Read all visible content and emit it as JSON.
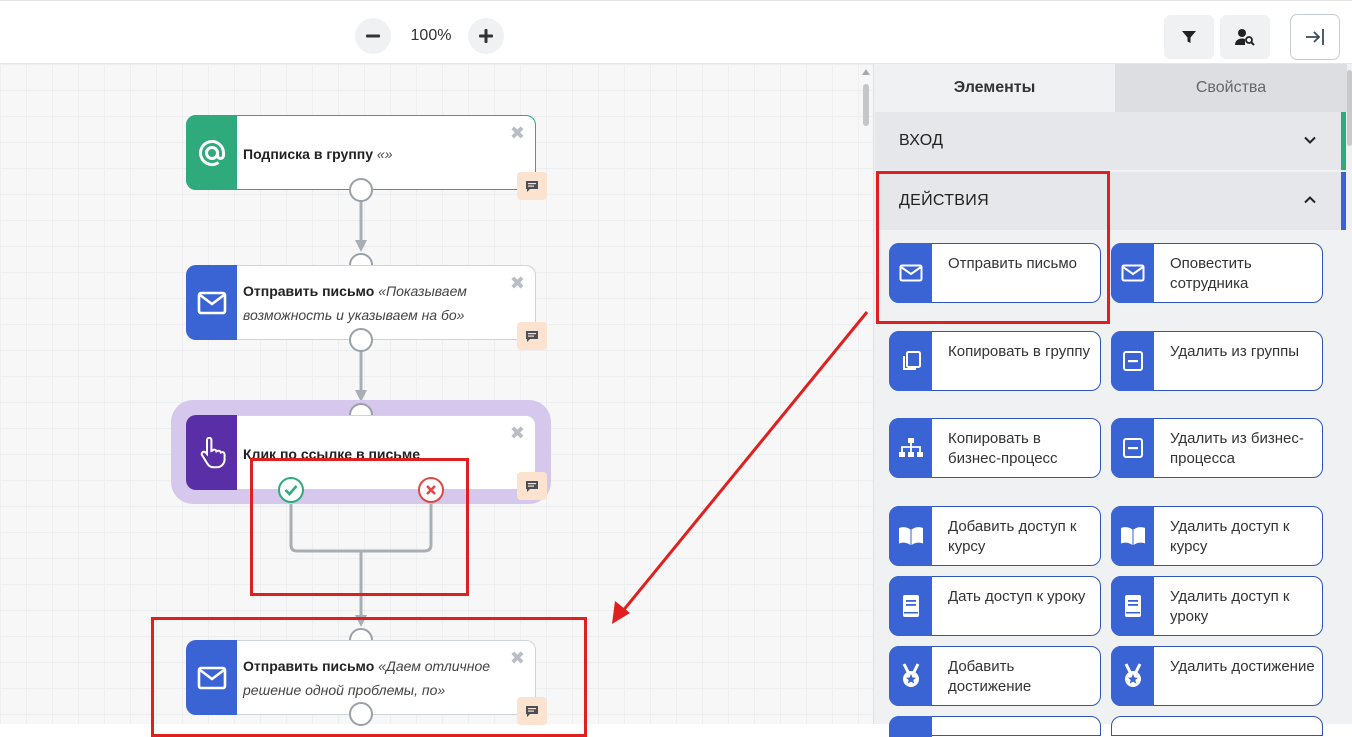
{
  "toolbar": {
    "zoom_level": "100%",
    "zoom_out_icon": "minus-icon",
    "zoom_in_icon": "plus-icon",
    "filter_icon": "filter-icon",
    "user_search_icon": "user-search-icon",
    "exit_icon": "collapse-panel-icon"
  },
  "canvas": {
    "nodes": [
      {
        "title": "Подписка в группу",
        "detail": "«»",
        "icon": "at-icon",
        "color": "#2eaa7c"
      },
      {
        "title": "Отправить письмо",
        "detail": "«Показываем возможность и указываем на бо»",
        "icon": "envelope-icon",
        "color": "#3a63d4"
      },
      {
        "title": "Клик по ссылке в письме",
        "detail": "",
        "icon": "hand-pointer-icon",
        "color": "#5a2ea6"
      },
      {
        "title": "Отправить письмо",
        "detail": "«Даем отличное решение одной проблемы, по»",
        "icon": "envelope-icon",
        "color": "#3a63d4"
      }
    ],
    "close_glyph": "✖",
    "yes_port_icon": "check-circle-icon",
    "no_port_icon": "x-circle-icon"
  },
  "panel": {
    "tabs": [
      {
        "label": "Элементы",
        "active": true
      },
      {
        "label": "Свойства",
        "active": false
      }
    ],
    "sections": [
      {
        "label": "ВХОД",
        "expanded": false,
        "accent": "#2eaa7c"
      },
      {
        "label": "ДЕЙСТВИЯ",
        "expanded": true,
        "accent": "#3a63d4"
      }
    ],
    "actions": [
      {
        "label": "Отправить письмо",
        "icon": "envelope-icon"
      },
      {
        "label": "Оповестить сотрудника",
        "icon": "envelope-icon"
      },
      {
        "label": "Копировать в группу",
        "icon": "copy-icon"
      },
      {
        "label": "Удалить из группы",
        "icon": "minus-square-icon"
      },
      {
        "label": "Копировать в бизнес-процесс",
        "icon": "sitemap-icon"
      },
      {
        "label": "Удалить из бизнес-процесса",
        "icon": "minus-square-icon"
      },
      {
        "label": "Добавить доступ к курсу",
        "icon": "book-open-icon"
      },
      {
        "label": "Удалить доступ к курсу",
        "icon": "book-open-icon"
      },
      {
        "label": "Дать доступ к уроку",
        "icon": "book-icon"
      },
      {
        "label": "Удалить доступ к уроку",
        "icon": "book-icon"
      },
      {
        "label": "Добавить достижение",
        "icon": "medal-icon"
      },
      {
        "label": "Удалить достижение",
        "icon": "medal-icon"
      }
    ]
  },
  "colors": {
    "accent_blue": "#3a63d4",
    "accent_green": "#2eaa7c",
    "accent_purple": "#5a2ea6",
    "annotation_red": "#e01f1f"
  }
}
